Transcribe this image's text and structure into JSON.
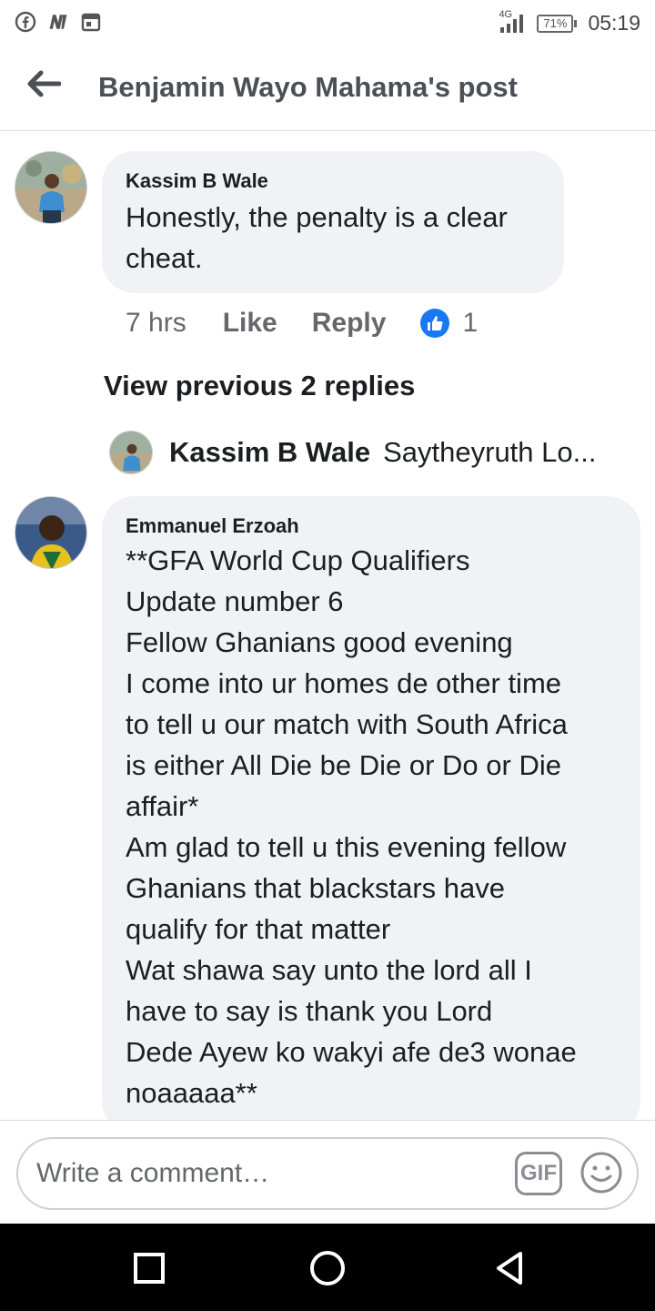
{
  "status_bar": {
    "network": "4G",
    "battery": "71%",
    "time": "05:19",
    "icons": [
      "facebook-icon",
      "news-icon",
      "calendar-icon",
      "signal-icon",
      "battery-icon"
    ]
  },
  "header": {
    "title": "Benjamin Wayo Mahama's post",
    "back_icon": "back-arrow-icon"
  },
  "comments": [
    {
      "author": "Kassim B Wale",
      "text": "Honestly, the penalty is a clear\ncheat.",
      "time": "7 hrs",
      "like_label": "Like",
      "reply_label": "Reply",
      "reaction_count": "1"
    },
    {
      "author": "Emmanuel Erzoah",
      "text": "**GFA World Cup Qualifiers\nUpdate number 6\nFellow Ghanians good evening\nI come into ur homes de other time\nto tell u our match with South Africa\nis either All Die be Die or Do or Die\naffair*\nAm glad to tell u this evening fellow\nGhanians that blackstars have\nqualify for that matter\nWat shawa say unto the lord all I\nhave to say is thank you Lord\nDede Ayew ko wakyi afe de3 wonae\nnoaaaaa**"
    }
  ],
  "replies": {
    "view_previous_label": "View previous 2 replies",
    "latest_reply_author": "Kassim B Wale",
    "latest_reply_preview": "Saytheyruth Lo..."
  },
  "composer": {
    "placeholder": "Write a comment…",
    "gif_label": "GIF"
  }
}
